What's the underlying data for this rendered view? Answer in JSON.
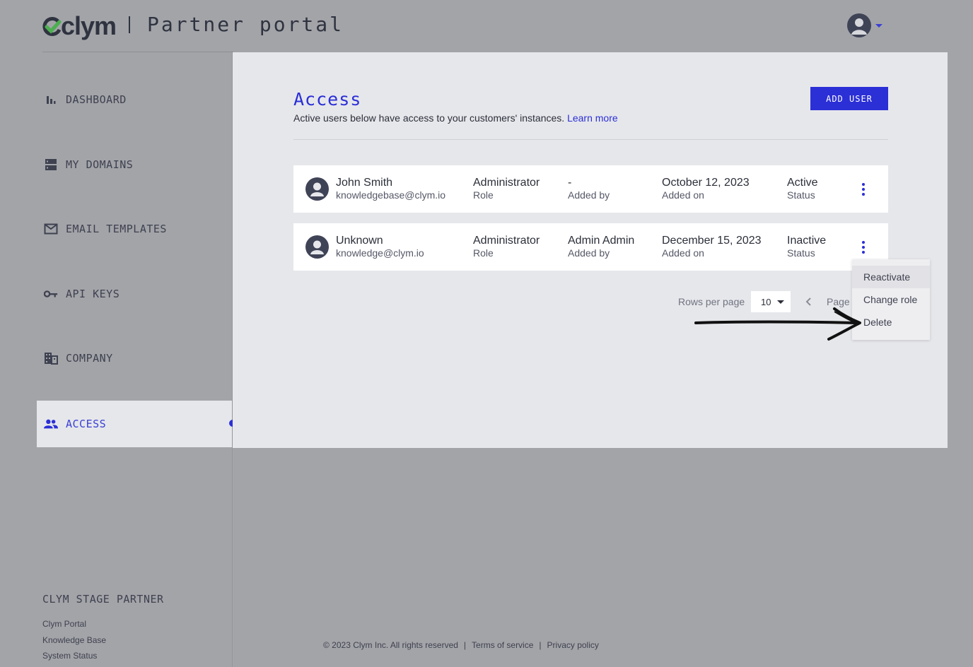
{
  "header": {
    "brand": "clym",
    "portal_title": "Partner portal"
  },
  "sidebar": {
    "items": [
      {
        "label": "DASHBOARD",
        "icon": "bar-chart-icon"
      },
      {
        "label": "MY DOMAINS",
        "icon": "server-icon"
      },
      {
        "label": "EMAIL TEMPLATES",
        "icon": "mail-icon"
      },
      {
        "label": "API KEYS",
        "icon": "key-icon"
      },
      {
        "label": "COMPANY",
        "icon": "building-icon"
      },
      {
        "label": "ACCESS",
        "icon": "people-icon",
        "active": true
      }
    ],
    "partner_name": "CLYM STAGE PARTNER",
    "links": [
      "Clym Portal",
      "Knowledge Base",
      "System Status"
    ]
  },
  "main": {
    "title": "Access",
    "subtitle": "Active users below have access to your customers' instances.",
    "learn_more": "Learn more",
    "add_user_label": "ADD USER",
    "users": [
      {
        "name": "John Smith",
        "email": "knowledgebase@clym.io",
        "role": "Administrator",
        "role_label": "Role",
        "added_by": "-",
        "added_by_label": "Added by",
        "added_on": "October 12, 2023",
        "added_on_label": "Added on",
        "status": "Active",
        "status_label": "Status"
      },
      {
        "name": "Unknown",
        "email": "knowledge@clym.io",
        "role": "Administrator",
        "role_label": "Role",
        "added_by": "Admin Admin",
        "added_by_label": "Added by",
        "added_on": "December 15, 2023",
        "added_on_label": "Added on",
        "status": "Inactive",
        "status_label": "Status"
      }
    ],
    "pagination": {
      "rows_per_page_label": "Rows per page",
      "rows_per_page_value": "10",
      "page_label": "Page"
    }
  },
  "context_menu": {
    "items": [
      "Reactivate",
      "Change role",
      "Delete"
    ]
  },
  "footer": {
    "copyright": "© 2023 Clym Inc. All rights reserved",
    "separator": "|",
    "terms": "Terms of service",
    "privacy": "Privacy policy"
  },
  "colors": {
    "accent": "#2b2fd6",
    "backdrop": "#a3a4a8",
    "panel": "#e6e7eb",
    "brand_green": "#4caf50"
  }
}
